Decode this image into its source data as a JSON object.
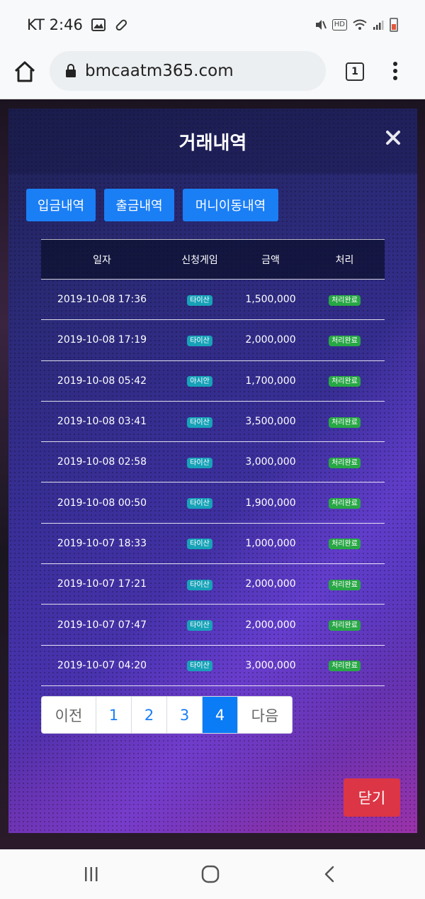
{
  "status_bar": {
    "carrier_time": "KT 2:46",
    "hd_label": "HD"
  },
  "browser": {
    "url": "bmcaatm365.com",
    "tab_count": "1"
  },
  "modal": {
    "title": "거래내역",
    "tabs": [
      {
        "label": "입금내역"
      },
      {
        "label": "출금내역"
      },
      {
        "label": "머니이동내역"
      }
    ],
    "table": {
      "headers": [
        "일자",
        "신청게임",
        "금액",
        "처리"
      ],
      "rows": [
        {
          "date": "2019-10-08 17:36",
          "game": "타이산",
          "amount": "1,500,000",
          "status": "처리완료"
        },
        {
          "date": "2019-10-08 17:19",
          "game": "타이산",
          "amount": "2,000,000",
          "status": "처리완료"
        },
        {
          "date": "2019-10-08 05:42",
          "game": "아시안",
          "amount": "1,700,000",
          "status": "처리완료"
        },
        {
          "date": "2019-10-08 03:41",
          "game": "타이산",
          "amount": "3,500,000",
          "status": "처리완료"
        },
        {
          "date": "2019-10-08 02:58",
          "game": "타이산",
          "amount": "3,000,000",
          "status": "처리완료"
        },
        {
          "date": "2019-10-08 00:50",
          "game": "타이산",
          "amount": "1,900,000",
          "status": "처리완료"
        },
        {
          "date": "2019-10-07 18:33",
          "game": "타이산",
          "amount": "1,000,000",
          "status": "처리완료"
        },
        {
          "date": "2019-10-07 17:21",
          "game": "타이산",
          "amount": "2,000,000",
          "status": "처리완료"
        },
        {
          "date": "2019-10-07 07:47",
          "game": "타이산",
          "amount": "2,000,000",
          "status": "처리완료"
        },
        {
          "date": "2019-10-07 04:20",
          "game": "타이산",
          "amount": "3,000,000",
          "status": "처리완료"
        }
      ]
    },
    "pagination": {
      "prev": "이전",
      "pages": [
        "1",
        "2",
        "3",
        "4"
      ],
      "active_page": "4",
      "next": "다음"
    },
    "close_button": "닫기"
  },
  "colors": {
    "primary": "#1a7ef5",
    "danger": "#dc3545",
    "game_badge": "#17a2b8",
    "status_badge": "#28a745"
  }
}
